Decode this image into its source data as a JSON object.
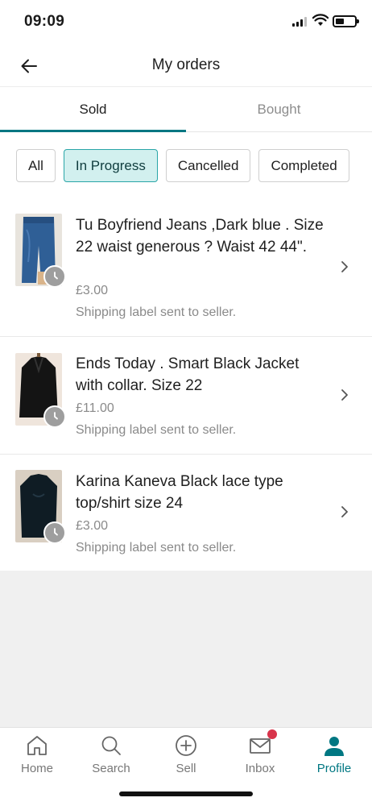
{
  "status_bar": {
    "time": "09:09"
  },
  "header": {
    "title": "My orders"
  },
  "tabs": [
    {
      "label": "Sold",
      "active": true
    },
    {
      "label": "Bought",
      "active": false
    }
  ],
  "filters": [
    {
      "label": "All",
      "selected": false
    },
    {
      "label": "In Progress",
      "selected": true
    },
    {
      "label": "Cancelled",
      "selected": false
    },
    {
      "label": "Completed",
      "selected": false
    }
  ],
  "orders": [
    {
      "title": "Tu Boyfriend Jeans ,Dark blue . Size 22  waist generous ? Waist 42 44\".",
      "price": "£3.00",
      "status": "Shipping label sent to seller.",
      "thumb": "jeans"
    },
    {
      "title": "Ends Today . Smart  Black Jacket with collar. Size 22",
      "price": "£11.00",
      "status": "Shipping label sent to seller.",
      "thumb": "jacket"
    },
    {
      "title": "Karina Kaneva Black lace type top/shirt  size 24",
      "price": "£3.00",
      "status": "Shipping label sent to seller.",
      "thumb": "shirt"
    }
  ],
  "bottom_nav": [
    {
      "label": "Home",
      "icon": "home-icon",
      "active": false
    },
    {
      "label": "Search",
      "icon": "search-icon",
      "active": false
    },
    {
      "label": "Sell",
      "icon": "sell-plus-icon",
      "active": false
    },
    {
      "label": "Inbox",
      "icon": "inbox-icon",
      "active": false,
      "badge": true
    },
    {
      "label": "Profile",
      "icon": "profile-icon",
      "active": true
    }
  ],
  "colors": {
    "accent": "#007782",
    "chip_selected_bg": "#d2f0ef",
    "badge": "#d8344b"
  }
}
